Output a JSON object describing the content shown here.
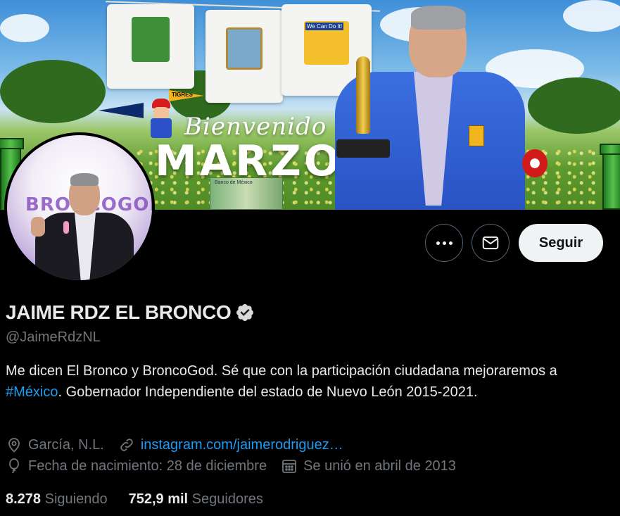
{
  "banner": {
    "greeting": "Bienvenido",
    "month": "MARZO",
    "shirt_badge": "We Can Do It!",
    "pennant_tigres": "TIGRES",
    "bill_text": "Banco de México"
  },
  "avatar": {
    "logo_text": "BRONCOGOD"
  },
  "actions": {
    "more_icon": "more-icon",
    "mail_icon": "mail-icon",
    "follow_label": "Seguir"
  },
  "profile": {
    "name": "JAIME RDZ EL BRONCO",
    "verified_icon": "verified-badge-icon",
    "handle": "@JaimeRdzNL",
    "bio_before": "Me dicen El Bronco y BroncoGod. Sé que con la participación ciudadana mejoraremos a ",
    "bio_hashtag": "#México",
    "bio_after": ".  Gobernador Independiente del estado de Nuevo León 2015-2021.",
    "location": "García, N.L.",
    "website": "instagram.com/jaimerodriguez…",
    "birthday": "Fecha de nacimiento: 28 de diciembre",
    "joined": "Se unió en abril de 2013"
  },
  "counts": {
    "following_value": "8.278",
    "following_label": "Siguiendo",
    "followers_value": "752,9 mil",
    "followers_label": "Seguidores"
  },
  "colors": {
    "background": "#000000",
    "accent": "#1d9bf0",
    "muted": "#71767b",
    "text": "#e7e9ea"
  }
}
